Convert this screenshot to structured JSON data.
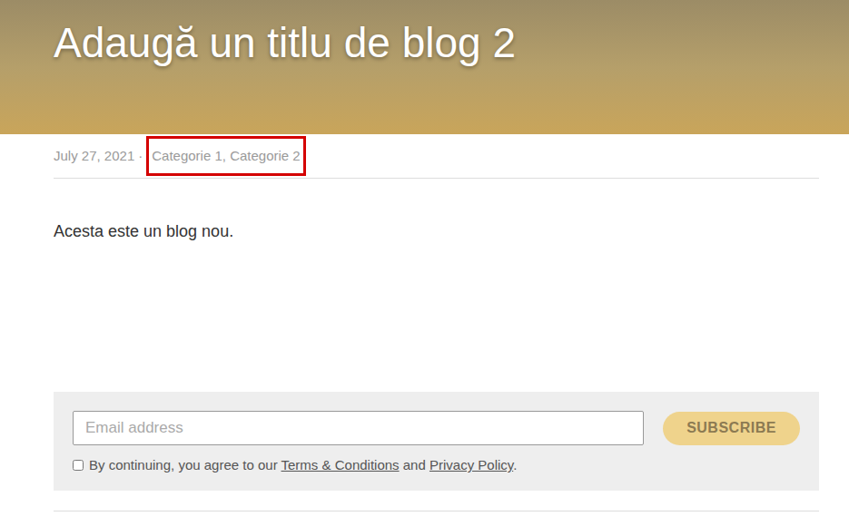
{
  "header": {
    "title": "Adaugă un titlu de blog 2"
  },
  "meta": {
    "date": "July 27, 2021",
    "dot": "·",
    "categories": [
      "Categorie 1",
      "Categorie 2"
    ],
    "category_separator": ", ",
    "categories_highlighted": true
  },
  "content": {
    "paragraph": "Acesta este un blog nou."
  },
  "subscribe": {
    "placeholder": "Email address",
    "button": "SUBSCRIBE",
    "consent": {
      "checked": false,
      "prefix": "By continuing, you agree to our ",
      "terms": "Terms & Conditions",
      "and": " and ",
      "privacy": "Privacy Policy",
      "suffix": "."
    }
  }
}
